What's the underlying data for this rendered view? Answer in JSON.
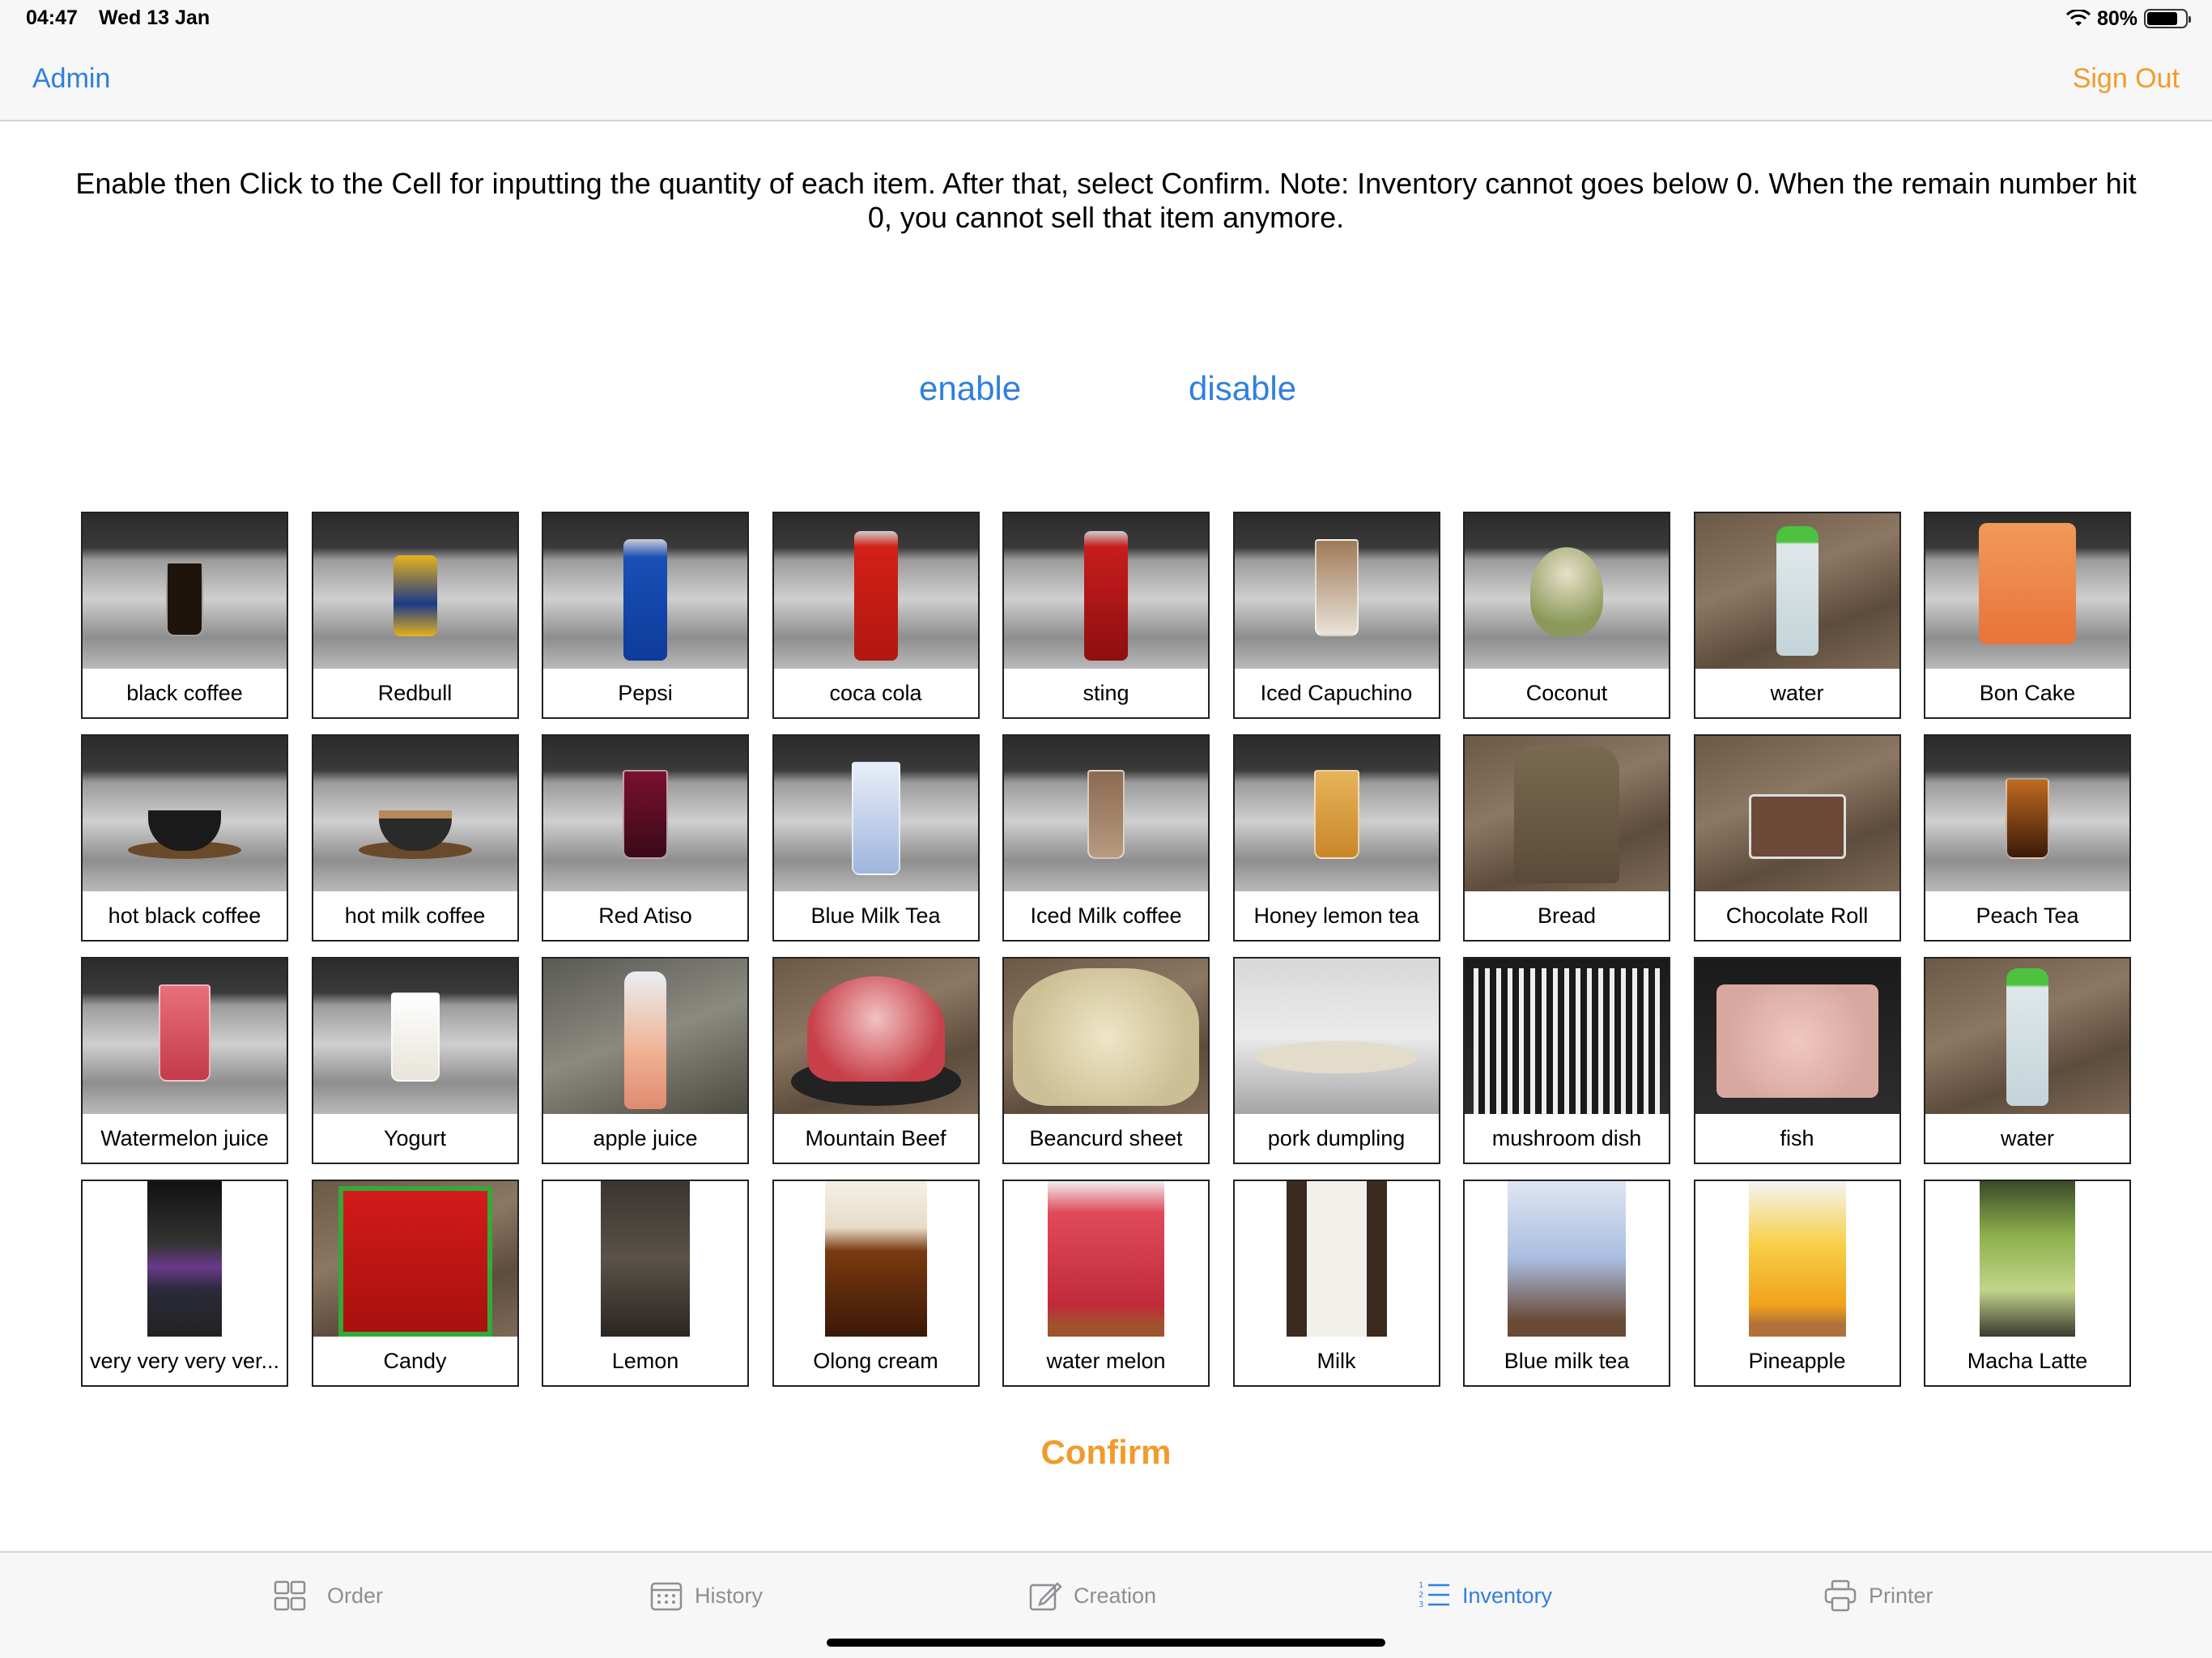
{
  "status_bar": {
    "time": "04:47",
    "date": "Wed 13 Jan",
    "battery_percent": "80%",
    "battery_level": 0.8,
    "wifi_icon": "wifi-icon"
  },
  "nav": {
    "left_label": "Admin",
    "right_label": "Sign Out",
    "left_color": "#2f7fe0",
    "right_color": "#f19b2c"
  },
  "instructions": "Enable then Click to the Cell for inputting the quantity of each item. After that, select Confirm. Note: Inventory cannot goes below 0. When the remain number hit 0, you cannot sell that item anymore.",
  "controls": {
    "enable_label": "enable",
    "disable_label": "disable",
    "confirm_label": "Confirm"
  },
  "items": [
    {
      "label": "black coffee"
    },
    {
      "label": "Redbull"
    },
    {
      "label": "Pepsi"
    },
    {
      "label": "coca cola"
    },
    {
      "label": "sting"
    },
    {
      "label": "Iced Capuchino"
    },
    {
      "label": "Coconut"
    },
    {
      "label": "water"
    },
    {
      "label": "Bon Cake"
    },
    {
      "label": "hot black coffee"
    },
    {
      "label": "hot milk coffee"
    },
    {
      "label": "Red Atiso"
    },
    {
      "label": "Blue Milk Tea"
    },
    {
      "label": "Iced Milk coffee"
    },
    {
      "label": "Honey lemon tea"
    },
    {
      "label": "Bread"
    },
    {
      "label": "Chocolate Roll"
    },
    {
      "label": "Peach Tea"
    },
    {
      "label": "Watermelon juice"
    },
    {
      "label": "Yogurt"
    },
    {
      "label": "apple juice"
    },
    {
      "label": "Mountain Beef"
    },
    {
      "label": "Beancurd sheet"
    },
    {
      "label": "pork dumpling"
    },
    {
      "label": "mushroom dish"
    },
    {
      "label": "fish"
    },
    {
      "label": "water"
    },
    {
      "label": "very very very ver..."
    },
    {
      "label": "Candy"
    },
    {
      "label": "Lemon"
    },
    {
      "label": "Olong cream"
    },
    {
      "label": "water melon"
    },
    {
      "label": "Milk"
    },
    {
      "label": "Blue milk tea"
    },
    {
      "label": "Pineapple"
    },
    {
      "label": "Macha Latte"
    }
  ],
  "tabs": [
    {
      "label": "Order",
      "icon": "grid-icon",
      "active": false
    },
    {
      "label": "History",
      "icon": "calendar-icon",
      "active": false
    },
    {
      "label": "Creation",
      "icon": "edit-icon",
      "active": false
    },
    {
      "label": "Inventory",
      "icon": "list-icon",
      "active": true
    },
    {
      "label": "Printer",
      "icon": "printer-icon",
      "active": false
    }
  ],
  "colors": {
    "accent_blue": "#2f7fe0",
    "accent_orange": "#f19b2c",
    "inactive_gray": "#8e8e93"
  }
}
